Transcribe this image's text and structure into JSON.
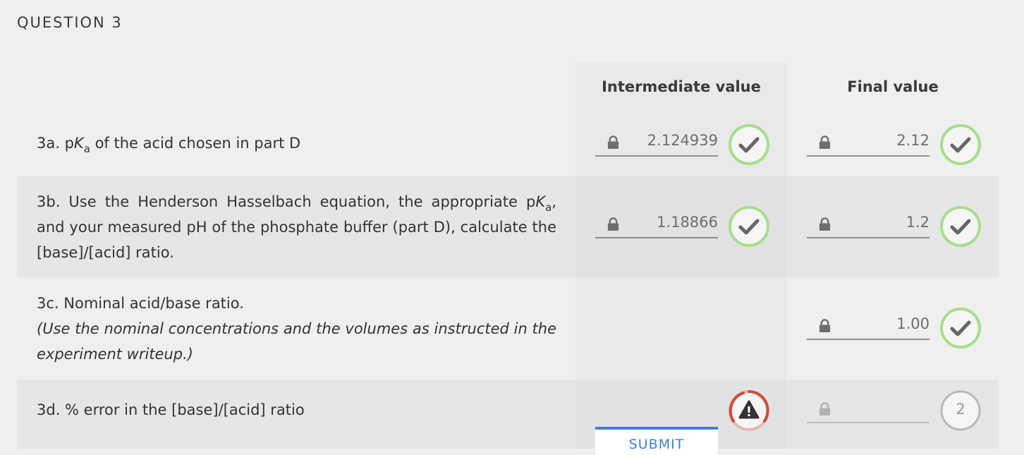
{
  "question_title": "QUESTION 3",
  "headers": {
    "intermediate": "Intermediate value",
    "final": "Final value"
  },
  "rows": [
    {
      "label_parts": [
        "3a. p",
        "K",
        "a",
        " of the acid chosen in part D"
      ],
      "intermediate": "2.124939",
      "final": "2.12",
      "intermediate_status": "correct",
      "final_status": "correct"
    },
    {
      "label_parts": [
        "3b. Use the Henderson Hasselbach equation, the appropriate p",
        "K",
        "a",
        ", and your measured pH of the phosphate buffer (part D), calculate the [base]/[acid] ratio."
      ],
      "intermediate": "1.18866",
      "final": "1.2",
      "intermediate_status": "correct",
      "final_status": "correct"
    },
    {
      "label": "3c. Nominal acid/base ratio.",
      "note": "(Use the nominal concentrations and the volumes as instructed in the experiment writeup.)",
      "final": "1.00",
      "final_status": "correct"
    },
    {
      "label": "3d. % error in the [base]/[acid] ratio",
      "intermediate_status": "warning",
      "final": "",
      "final_status": "attempts",
      "attempts_left": "2"
    }
  ],
  "submit_label": "SUBMIT",
  "colors": {
    "correct": "#a6df8a",
    "check": "#666666",
    "warning_red": "#d24b34",
    "warning_light": "#e8b8ae",
    "pending": "#b9b9b9",
    "submit": "#3f7fd0"
  }
}
